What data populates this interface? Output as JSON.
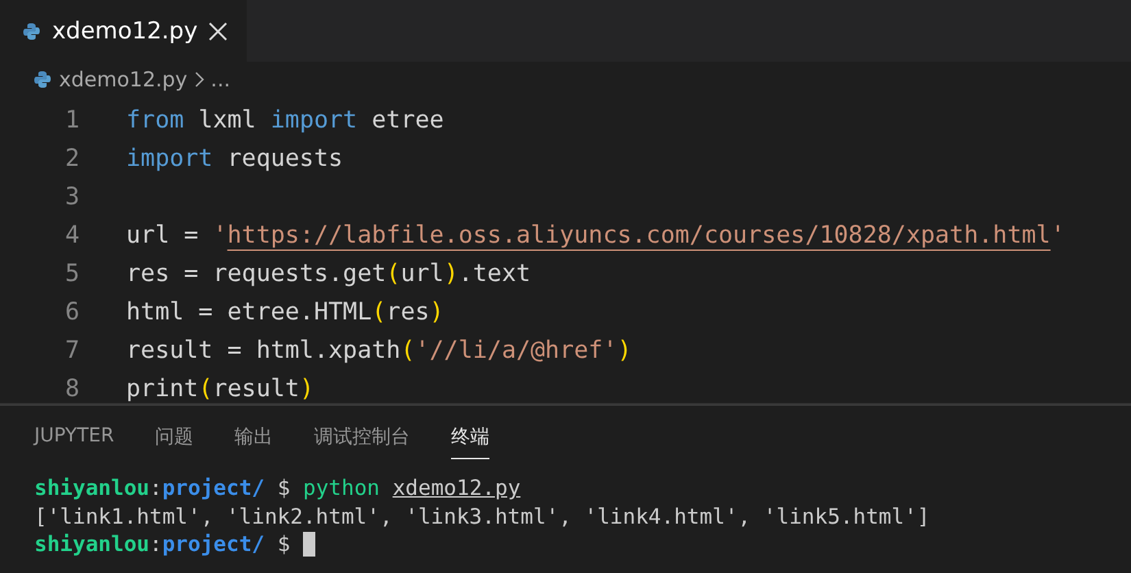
{
  "editor_tabs": [
    {
      "label": "xdemo12.py",
      "selected": true
    }
  ],
  "breadcrumb": {
    "file": "xdemo12.py",
    "rest": "..."
  },
  "code_lines": [
    {
      "number": "1",
      "tokens": [
        {
          "kind": "keyword",
          "text": "from"
        },
        {
          "kind": "plain",
          "text": " lxml "
        },
        {
          "kind": "keyword",
          "text": "import"
        },
        {
          "kind": "plain",
          "text": " etree"
        }
      ]
    },
    {
      "number": "2",
      "tokens": [
        {
          "kind": "keyword",
          "text": "import"
        },
        {
          "kind": "plain",
          "text": " requests"
        }
      ]
    },
    {
      "number": "3"
    },
    {
      "number": "4",
      "tokens": [
        {
          "kind": "plain",
          "text": "url = "
        },
        {
          "kind": "string",
          "text": "'"
        },
        {
          "kind": "link",
          "text": "https://labfile.oss.aliyuncs.com/courses/10828/xpath.html"
        },
        {
          "kind": "string",
          "text": "'"
        }
      ]
    },
    {
      "number": "5",
      "tokens": [
        {
          "kind": "plain",
          "text": "res = requests.get"
        },
        {
          "kind": "bracket",
          "text": "("
        },
        {
          "kind": "plain",
          "text": "url"
        },
        {
          "kind": "bracket",
          "text": ")"
        },
        {
          "kind": "plain",
          "text": ".text"
        }
      ]
    },
    {
      "number": "6",
      "tokens": [
        {
          "kind": "plain",
          "text": "html = etree.HTML"
        },
        {
          "kind": "bracket",
          "text": "("
        },
        {
          "kind": "plain",
          "text": "res"
        },
        {
          "kind": "bracket",
          "text": ")"
        }
      ]
    },
    {
      "number": "7",
      "tokens": [
        {
          "kind": "plain",
          "text": "result = html.xpath"
        },
        {
          "kind": "bracket",
          "text": "("
        },
        {
          "kind": "string",
          "text": "'//li/a/@href'"
        },
        {
          "kind": "bracket",
          "text": ")"
        }
      ]
    },
    {
      "number": "8",
      "tokens": [
        {
          "kind": "plain",
          "text": "print"
        },
        {
          "kind": "bracket",
          "text": "("
        },
        {
          "kind": "plain",
          "text": "result"
        },
        {
          "kind": "bracket",
          "text": ")"
        }
      ]
    }
  ],
  "panel_tabs": [
    {
      "label": "JUPYTER",
      "selected": false
    },
    {
      "label": "问题",
      "selected": false
    },
    {
      "label": "输出",
      "selected": false
    },
    {
      "label": "调试控制台",
      "selected": false
    },
    {
      "label": "终端",
      "selected": true
    }
  ],
  "terminal_lines": [
    {
      "cursor": false,
      "segments": [
        {
          "kind": "user",
          "text": "shiyanlou"
        },
        {
          "kind": "plain",
          "text": ":"
        },
        {
          "kind": "path",
          "text": "project/"
        },
        {
          "kind": "plain",
          "text": " $ "
        },
        {
          "kind": "command",
          "text": "python "
        },
        {
          "kind": "file",
          "text": "xdemo12.py"
        }
      ]
    },
    {
      "cursor": false,
      "segments": [
        {
          "kind": "plain",
          "text": "['link1.html', 'link2.html', 'link3.html', 'link4.html', 'link5.html']"
        }
      ]
    },
    {
      "cursor": true,
      "segments": [
        {
          "kind": "user",
          "text": "shiyanlou"
        },
        {
          "kind": "plain",
          "text": ":"
        },
        {
          "kind": "path",
          "text": "project/"
        },
        {
          "kind": "plain",
          "text": " $ "
        }
      ]
    }
  ]
}
